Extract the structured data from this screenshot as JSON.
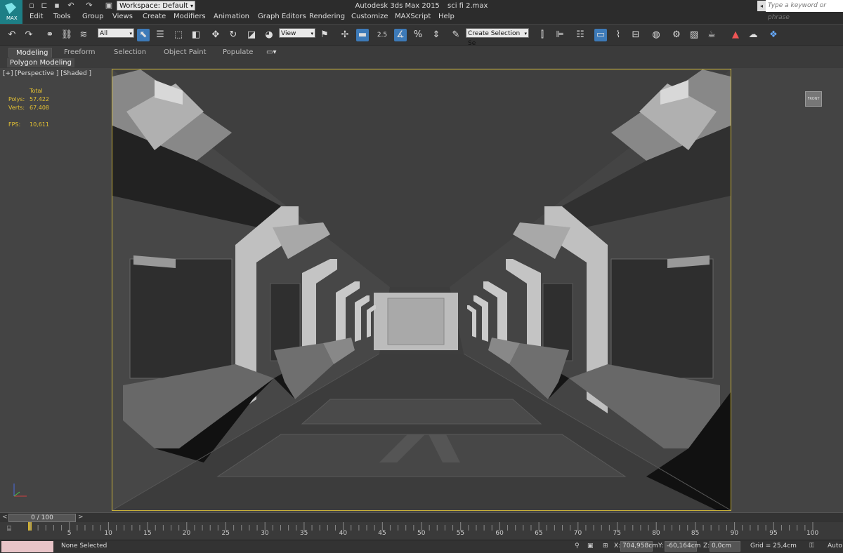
{
  "titlebar": {
    "workspace": "Workspace: Default",
    "app_name": "Autodesk 3ds Max  2015",
    "file_name": "sci fi 2.max",
    "search_placeholder": "Type a keyword or phrase",
    "logo_text": "MAX"
  },
  "menu": [
    "Edit",
    "Tools",
    "Group",
    "Views",
    "Create",
    "Modifiers",
    "Animation",
    "Graph Editors",
    "Rendering",
    "Customize",
    "MAXScript",
    "Help"
  ],
  "toolbar": {
    "selection_filter": "All",
    "reference_coord": "View",
    "snap_label": "2.5",
    "selection_set": "Create Selection Se"
  },
  "ribbon": {
    "tabs": [
      "Modeling",
      "Freeform",
      "Selection",
      "Object Paint",
      "Populate"
    ],
    "active_tab": "Modeling",
    "subtab": "Polygon Modeling"
  },
  "viewport": {
    "label": "[+] [Perspective ] [Shaded ]",
    "stats": {
      "header": "Total",
      "polys_label": "Polys:",
      "polys_value": "57.422",
      "verts_label": "Verts:",
      "verts_value": "67.408",
      "fps_label": "FPS:",
      "fps_value": "10,611"
    },
    "viewcube_text": "FRONT",
    "colors": {
      "frame_border": "#c9b23a",
      "stats_text": "#e5c233"
    }
  },
  "timeline": {
    "frame_display": "0 / 100",
    "ticks": [
      "5",
      "10",
      "15",
      "20",
      "25",
      "30",
      "35",
      "40",
      "45",
      "50",
      "55",
      "60",
      "65",
      "70",
      "75",
      "80",
      "85",
      "90",
      "95",
      "100"
    ]
  },
  "status": {
    "selection": "None Selected",
    "x_label": "X:",
    "x_value": "704,958cm",
    "y_label": "Y:",
    "y_value": "-60,164cm",
    "z_label": "Z:",
    "z_value": "0,0cm",
    "grid": "Grid = 25,4cm",
    "auto_label": "Auto"
  }
}
